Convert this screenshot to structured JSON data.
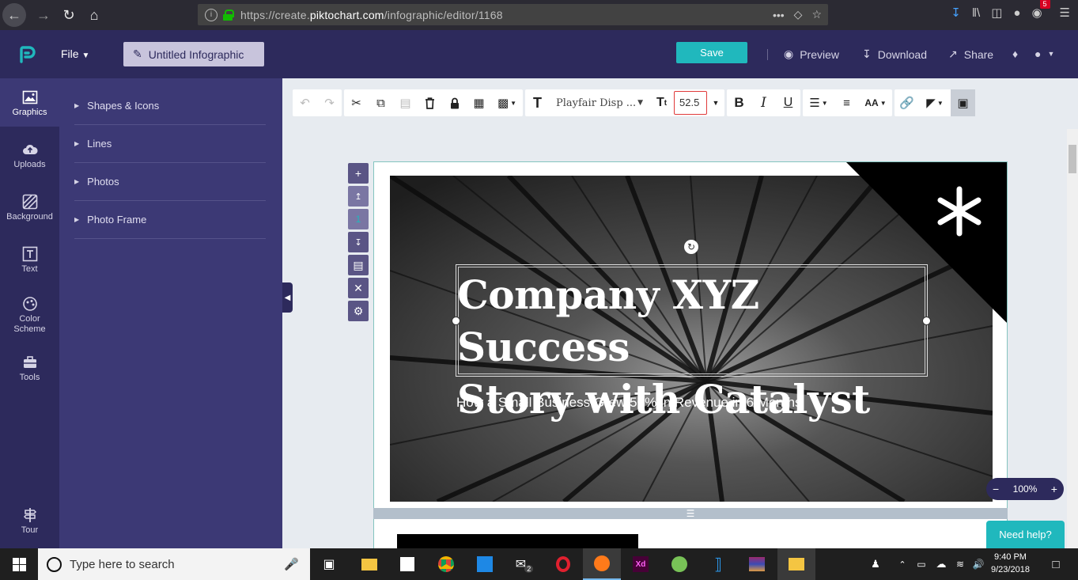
{
  "browser": {
    "url_prefix": "https://create.",
    "url_domain": "piktochart.com",
    "url_path": "/infographic/editor/1168",
    "notification_count": "5"
  },
  "header": {
    "file_menu": "File",
    "doc_title": "Untitled Infographic",
    "save_label": "Save",
    "preview_label": "Preview",
    "download_label": "Download",
    "share_label": "Share"
  },
  "rail": {
    "items": [
      {
        "label": "Graphics",
        "icon": "image-icon"
      },
      {
        "label": "Uploads",
        "icon": "cloud-upload-icon"
      },
      {
        "label": "Background",
        "icon": "background-icon"
      },
      {
        "label": "Text",
        "icon": "text-icon"
      },
      {
        "label": "Color Scheme",
        "icon": "palette-icon"
      },
      {
        "label": "Tools",
        "icon": "toolbox-icon"
      },
      {
        "label": "Tour",
        "icon": "signpost-icon"
      }
    ]
  },
  "panel": {
    "items": [
      "Shapes & Icons",
      "Lines",
      "Photos",
      "Photo Frame"
    ]
  },
  "toolbar": {
    "font_name": "Playfair Disp ...",
    "font_size": "52.5"
  },
  "block_controls": {
    "block_number": "1"
  },
  "canvas": {
    "title_line1": "Company XYZ Success",
    "title_line2": "Story with Catalyst",
    "subtitle": "How a Small Business Grew 50% in Revenue in 6 Months"
  },
  "zoom": {
    "level": "100%",
    "minus": "−",
    "plus": "+"
  },
  "help": {
    "label": "Need help?"
  },
  "taskbar": {
    "search_placeholder": "Type here to search",
    "mail_badge": "2",
    "time": "9:40 PM",
    "date": "9/23/2018"
  },
  "colors": {
    "header_bg": "#2d2a5c",
    "panel_bg": "#3c3975",
    "accent": "#20b8bd"
  }
}
